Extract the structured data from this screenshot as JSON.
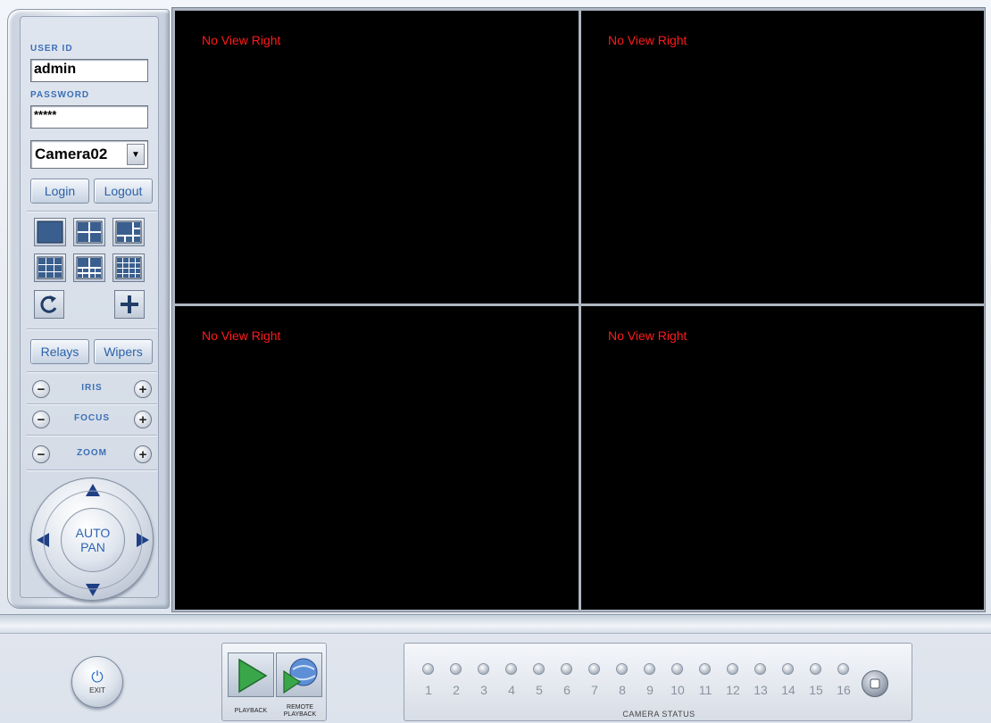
{
  "login": {
    "user_id_label": "USER ID",
    "user_id_value": "admin",
    "password_label": "PASSWORD",
    "password_value": "*****",
    "camera_selected": "Camera02",
    "login_label": "Login",
    "logout_label": "Logout"
  },
  "controls": {
    "relays_label": "Relays",
    "wipers_label": "Wipers",
    "iris_label": "IRIS",
    "focus_label": "FOCUS",
    "zoom_label": "ZOOM",
    "ptz_center_line1": "AUTO",
    "ptz_center_line2": "PAN"
  },
  "panes": [
    {
      "message": "No View Right"
    },
    {
      "message": "No View Right"
    },
    {
      "message": "No View Right"
    },
    {
      "message": "No View Right"
    }
  ],
  "bottom": {
    "exit_label": "EXIT",
    "playback_label": "PLAYBACK",
    "remote_playback_label": "REMOTE PLAYBACK",
    "camera_status_title": "CAMERA STATUS",
    "camera_numbers": [
      "1",
      "2",
      "3",
      "4",
      "5",
      "6",
      "7",
      "8",
      "9",
      "10",
      "11",
      "12",
      "13",
      "14",
      "15",
      "16"
    ]
  },
  "colors": {
    "accent_blue": "#2b61a9",
    "pane_bg": "#000000",
    "pane_msg": "#ff1a1a"
  }
}
